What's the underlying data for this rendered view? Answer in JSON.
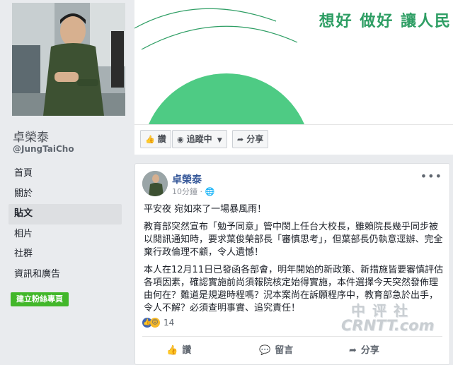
{
  "profile": {
    "name": "卓榮泰",
    "handle": "@JungTaiCho"
  },
  "nav": {
    "items": [
      "首頁",
      "關於",
      "貼文",
      "相片",
      "社群",
      "資訊和廣告"
    ],
    "active_index": 2
  },
  "cta": {
    "label": "建立粉絲專頁"
  },
  "cover": {
    "slogan": "想好 做好 讓人民"
  },
  "page_actions": {
    "like": "讚",
    "follow": "追蹤中",
    "share": "分享"
  },
  "post": {
    "author": "卓榮泰",
    "time": "10分鐘",
    "paragraphs": [
      "平安夜 宛如來了一場暴風雨！",
      "教育部突然宣布「勉予同意」管中閔上任台大校長，雖賴院長幾乎同步被以閱訊通知時，要求葉俊榮部長「審慎思考」，但葉部長仍執意逕辦、完全棄行政倫理不顧，令人遺憾！",
      "本人在12月11日已發函各部會，明年開始的新政策、新措施皆要審慎評估各項因素，確認實施前尚須報院核定始得實施，本件選擇今天突然發佈理由何在？難道是規避時程嗎？況本案尚在訴願程序中，教育部急於出手，令人不解？必須查明事實、追究責任！"
    ],
    "reaction_count": "14",
    "actions": {
      "like": "讚",
      "comment": "留言",
      "share": "分享"
    }
  },
  "watermark": {
    "line1": "中评社",
    "line2": "CRNTT.com"
  },
  "colors": {
    "slogan_green": "#2e9e64",
    "cover_circle": "#4ecb84",
    "link_blue": "#365899",
    "cta_green": "#42b72a"
  }
}
